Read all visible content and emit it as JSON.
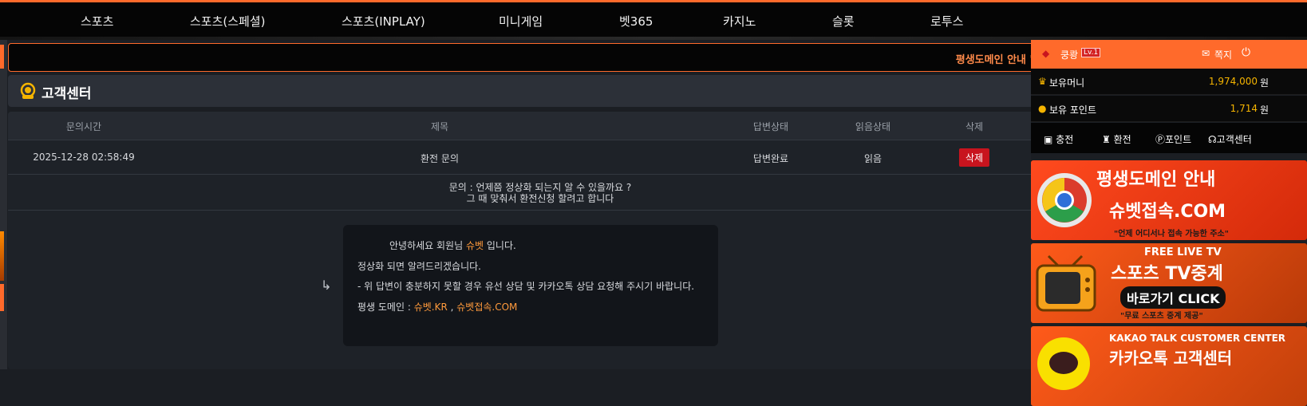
{
  "topnav": {
    "items": [
      "스포츠",
      "스포츠(스페셜)",
      "스포츠(INPLAY)",
      "미니게임",
      "벳365",
      "카지노",
      "슬롯",
      "로투스"
    ]
  },
  "ticker": {
    "text": "평생도메인 안내 \"슈벳.I"
  },
  "cs": {
    "title": "고객센터"
  },
  "table": {
    "headers": [
      "문의시간",
      "제목",
      "답변상태",
      "읽음상태",
      "삭제"
    ],
    "rows": [
      {
        "time": "2025-12-28 02:58:49",
        "subject": "환전 문의",
        "answer_status": "답변완료",
        "read_status": "읽음",
        "delete_label": "삭제"
      }
    ],
    "question": {
      "line1": "문의 : 언제쯤 정상화 되는지 알 수 있을까요 ?",
      "line2": "그 때 맞춰서 환전신청 할려고 합니다"
    }
  },
  "reply": {
    "arrow": "↳",
    "greeting_pre": "안녕하세요 회원님 ",
    "greeting_brand": "슈벳",
    "greeting_post": " 입니다.",
    "line2": "정상화 되면 알려드리겠습니다.",
    "line3": "- 위 답변이 충분하지 못할 경우 유선 상담 및 카카오톡 상담 요청해 주시기 바랍니다.",
    "domain_label": "평생 도메인 : ",
    "domain1": "슈벳.KR",
    "domain_sep": " , ",
    "domain2": "슈벳접속.COM"
  },
  "user": {
    "name": "쿵쾅",
    "level": "Lv.1",
    "message_label": "쪽지",
    "money_label": "보유머니",
    "money_value": "1,974,000",
    "point_label": "보유 포인트",
    "point_value": "1,714",
    "unit": "원"
  },
  "quick": [
    "충전",
    "환전",
    "포인트",
    "고객센터"
  ],
  "banners": [
    {
      "line1": "평생도메인 안내",
      "line2": "슈벳접속.COM",
      "line3": "\"언제 어디서나 접속 가능한 주소\""
    },
    {
      "line1": "FREE LIVE TV",
      "line2": "스포츠 TV중계",
      "line3": "바로가기 CLICK",
      "line4": "\"무료 스포츠 중계 제공\""
    },
    {
      "line1": "KAKAO TALK CUSTOMER CENTER",
      "line2": "카카오톡 고객센터"
    }
  ],
  "colors": {
    "accent": "#ff6a2b",
    "highlight": "#ff9a3c",
    "delete": "#c8141e",
    "gold": "#f5b400"
  }
}
